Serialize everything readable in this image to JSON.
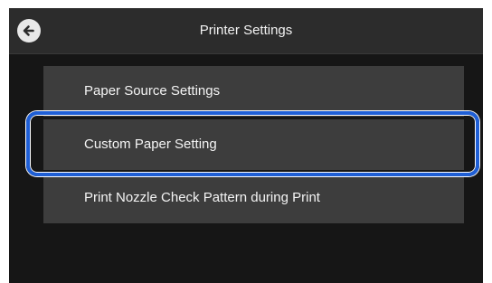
{
  "header": {
    "title": "Printer Settings",
    "back_icon": "arrow-left-icon"
  },
  "menu": {
    "items": [
      {
        "label": "Paper Source Settings"
      },
      {
        "label": "Custom Paper Setting",
        "highlighted": true
      },
      {
        "label": "Print Nozzle Check Pattern during Print"
      }
    ]
  },
  "colors": {
    "screen_background": "#161616",
    "header_background": "#2c2c2c",
    "item_background": "#3d3d3d",
    "highlight_border": "#1f5fd6"
  }
}
